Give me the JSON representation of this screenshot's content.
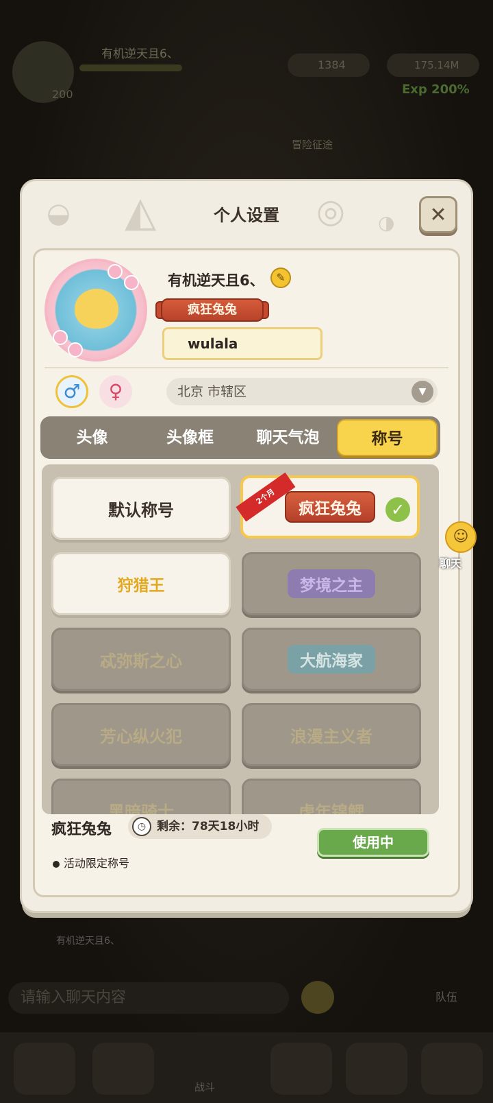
{
  "background": {
    "player_name": "有机逆天且6、",
    "coins": "1384",
    "gems": "175.14M",
    "level": "200",
    "exp_boost": "Exp 200%",
    "adventure_pass": "冒险征途",
    "chat_sender": "有机逆天且6、",
    "chat_placeholder": "请输入聊天内容",
    "team_label": "队伍",
    "battle_label": "战斗"
  },
  "modal": {
    "title": "个人设置",
    "close_icon": "close-icon"
  },
  "profile": {
    "username": "有机逆天且6、",
    "edit_icon": "pencil-icon",
    "current_title": "疯狂兔兔",
    "signature": "wulala",
    "gender_male_icon": "male-icon",
    "gender_female_icon": "female-icon",
    "region": "北京 市辖区"
  },
  "tabs": [
    {
      "label": "头像",
      "active": false
    },
    {
      "label": "头像框",
      "active": false
    },
    {
      "label": "聊天气泡",
      "active": false
    },
    {
      "label": "称号",
      "active": true
    }
  ],
  "titles": [
    {
      "label": "默认称号",
      "state": "unlocked"
    },
    {
      "label": "疯狂兔兔",
      "state": "selected",
      "ribbon": "2个月"
    },
    {
      "label": "狩猎王",
      "state": "unlocked"
    },
    {
      "label": "梦境之主",
      "state": "locked"
    },
    {
      "label": "忒弥斯之心",
      "state": "locked"
    },
    {
      "label": "大航海家",
      "state": "locked"
    },
    {
      "label": "芳心纵火犯",
      "state": "locked"
    },
    {
      "label": "浪漫主义者",
      "state": "locked"
    },
    {
      "label": "黑暗骑士",
      "state": "locked"
    },
    {
      "label": "虎年锦鲤",
      "state": "locked"
    }
  ],
  "footer": {
    "selected_title": "疯狂兔兔",
    "remaining": "剩余：78天18小时",
    "status_button": "使用中",
    "note": "活动限定称号"
  },
  "chat_float": {
    "label": "聊天"
  }
}
